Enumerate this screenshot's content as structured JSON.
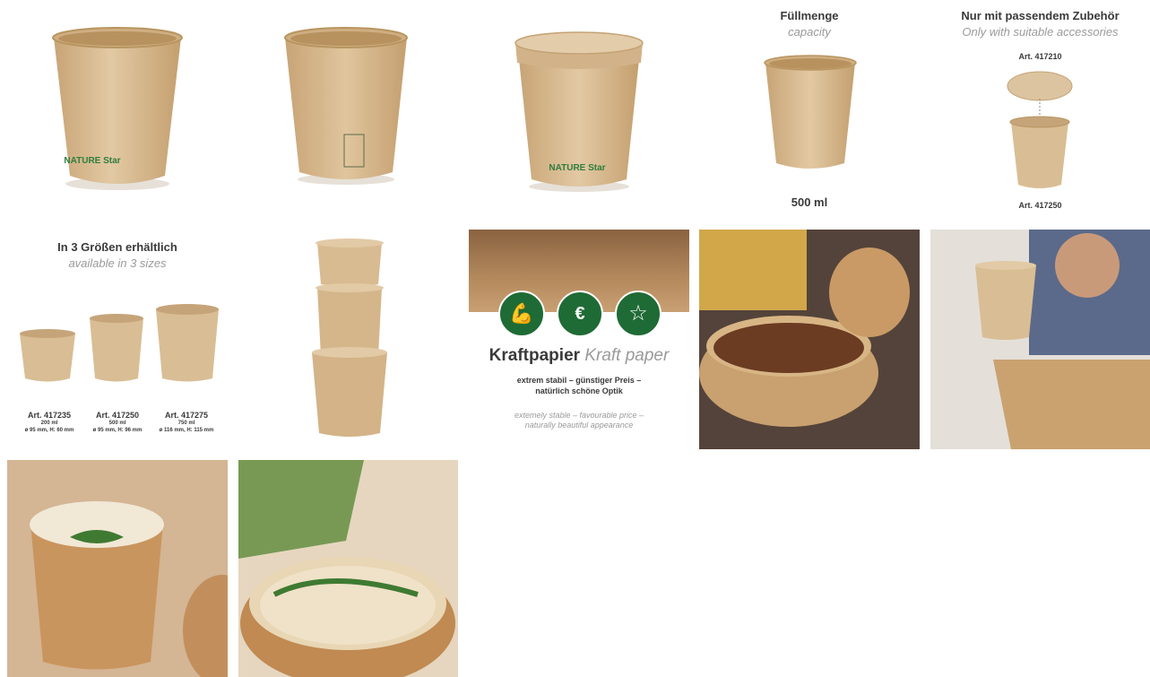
{
  "brand": {
    "logo_text": "NATURE Star"
  },
  "tile_capacity": {
    "title": "Füllmenge",
    "subtitle": "capacity",
    "volume": "500 ml"
  },
  "tile_accessories": {
    "title": "Nur mit passendem Zubehör",
    "subtitle": "Only with suitable accessories",
    "lid_art": "Art. 417210",
    "cup_art": "Art. 417250"
  },
  "tile_sizes": {
    "title": "In 3 Größen erhältlich",
    "subtitle": "available in 3 sizes",
    "sizes": [
      {
        "art": "Art. 417235",
        "volume": "200 ml",
        "dims": "ø 95 mm, H: 60 mm"
      },
      {
        "art": "Art. 417250",
        "volume": "500 ml",
        "dims": "ø 95 mm, H: 96 mm"
      },
      {
        "art": "Art. 417275",
        "volume": "750 ml",
        "dims": "ø 116 mm, H: 115 mm"
      }
    ]
  },
  "tile_kraft": {
    "title_de": "Kraftpapier",
    "title_en": "Kraft paper",
    "desc_de_1": "extrem stabil – günstiger Preis –",
    "desc_de_2": "natürlich schöne Optik",
    "desc_en_1": "extemely stable – favourable price –",
    "desc_en_2": "naturally beautiful appearance",
    "badge_price_symbol": "€"
  },
  "colors": {
    "kraft": "#d6b88e",
    "kraft_dark": "#c29d6c",
    "brand_green": "#2e7d3e",
    "badge_green": "#1f6b35"
  }
}
